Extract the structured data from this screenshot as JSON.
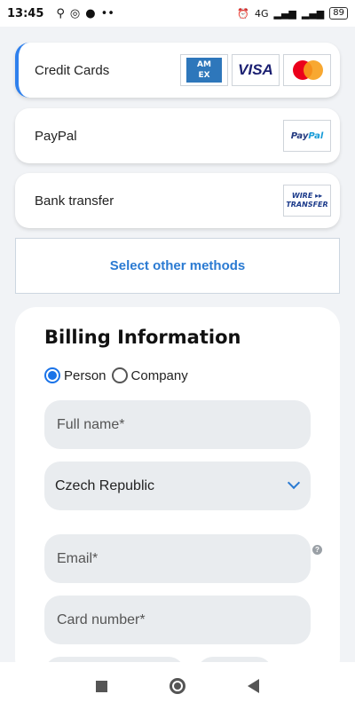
{
  "status_bar": {
    "time": "13:45",
    "battery": "89",
    "network": "4G"
  },
  "payment_methods": [
    {
      "label": "Credit Cards",
      "logos": [
        "amex-logo",
        "visa-logo",
        "mastercard-logo"
      ]
    },
    {
      "label": "PayPal",
      "logos": [
        "paypal-logo"
      ]
    },
    {
      "label": "Bank transfer",
      "logos": [
        "wire-transfer-logo"
      ]
    }
  ],
  "logos": {
    "amex_line1": "AM",
    "amex_line2": "EX",
    "visa": "VISA",
    "paypal_a": "Pay",
    "paypal_b": "Pal",
    "wire_line1": "WIRE ▸▸",
    "wire_line2": "TRANSFER"
  },
  "other_methods_label": "Select other methods",
  "billing": {
    "title": "Billing Information",
    "radio_person": "Person",
    "radio_company": "Company",
    "selected_type": "Person",
    "full_name_placeholder": "Full name*",
    "country_value": "Czech Republic",
    "email_placeholder": "Email*",
    "card_number_placeholder": "Card number*",
    "help_glyph": "?"
  },
  "colors": {
    "accent": "#2f80ed",
    "link": "#2a7ad2",
    "field_bg": "#e9ecef"
  }
}
